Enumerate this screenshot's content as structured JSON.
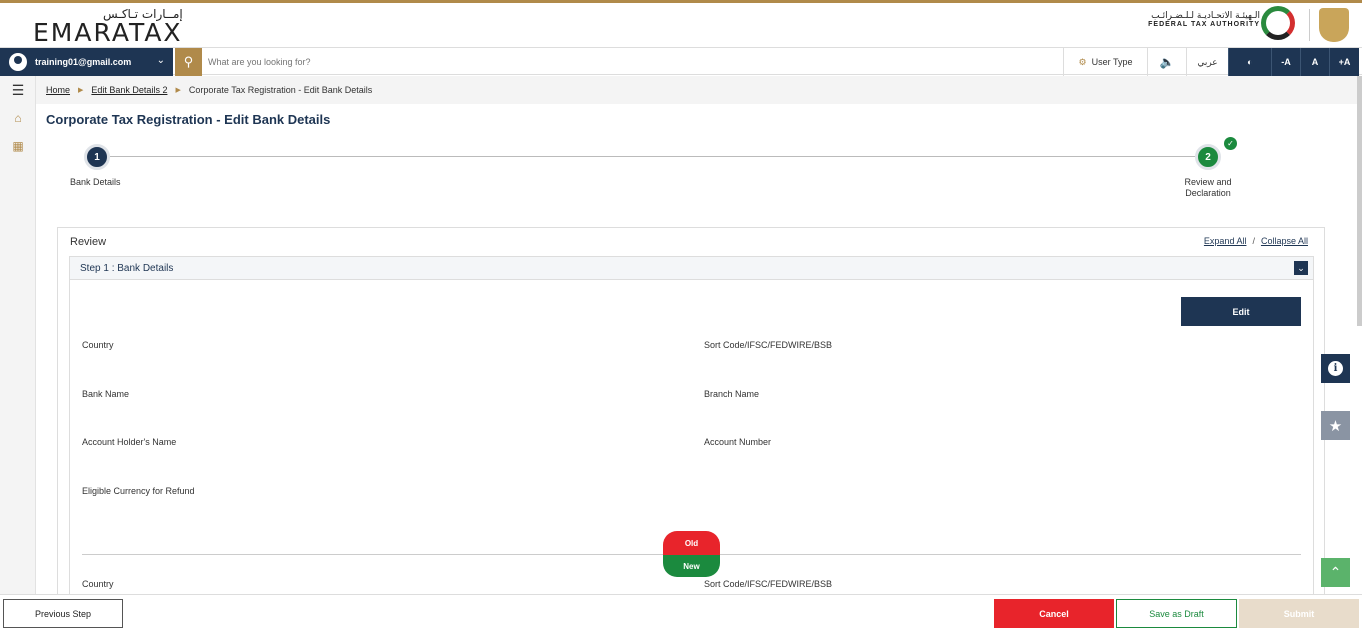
{
  "header": {
    "logo_ar": "إمــارات تـاكـس",
    "logo_en": "EMARATAX",
    "authority_ar": "الـهيئـة الاتحـاديـة لـلـضـرائـب",
    "authority_en": "FEDERAL TAX AUTHORITY"
  },
  "topbar": {
    "user_email": "training01@gmail.com",
    "search_placeholder": "What are you looking for?",
    "user_type": "User Type",
    "language": "عربي",
    "font_decrease": "-A",
    "font_normal": "A",
    "font_increase": "+A"
  },
  "breadcrumb": {
    "home": "Home",
    "parent": "Edit Bank Details 2",
    "current": "Corporate Tax Registration - Edit Bank Details"
  },
  "page_title": "Corporate Tax Registration - Edit Bank Details",
  "stepper": {
    "step1_number": "1",
    "step1_label": "Bank Details",
    "step2_number": "2",
    "step2_label": "Review and Declaration"
  },
  "review": {
    "title": "Review",
    "expand_all": "Expand All",
    "separator": "/",
    "collapse_all": "Collapse All",
    "section_title": "Step 1 : Bank Details",
    "edit_label": "Edit",
    "fields": {
      "country": "Country",
      "sort_code": "Sort Code/IFSC/FEDWIRE/BSB",
      "bank_name": "Bank Name",
      "branch_name": "Branch Name",
      "account_holder": "Account Holder's Name",
      "account_number": "Account Number",
      "eligible_currency": "Eligible Currency for Refund"
    },
    "old_label": "Old",
    "new_label": "New",
    "new_fields": {
      "country": "Country",
      "sort_code": "Sort Code/IFSC/FEDWIRE/BSB"
    }
  },
  "footer": {
    "previous": "Previous Step",
    "cancel": "Cancel",
    "save_draft": "Save as Draft",
    "submit": "Submit"
  },
  "colors": {
    "primary": "#1e3553",
    "gold": "#b08a4a",
    "green": "#1b8a3e",
    "red": "#e8242b"
  }
}
